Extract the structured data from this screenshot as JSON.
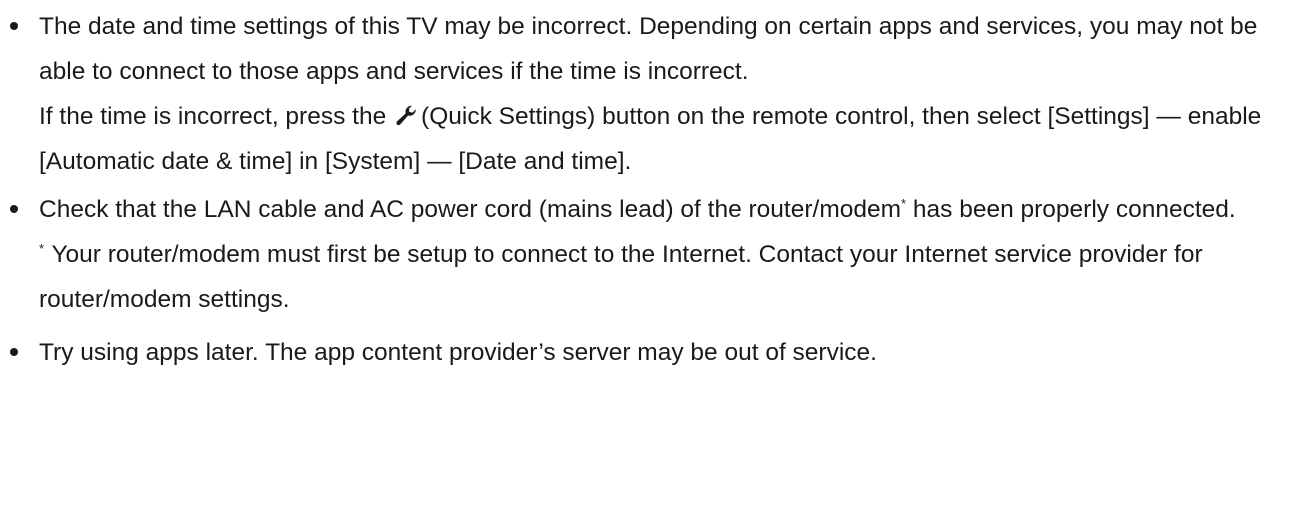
{
  "bullets": {
    "item1": {
      "para1": "The date and time settings of this TV may be incorrect. Depending on certain apps and services, you may not be able to connect to those apps and services if the time is incorrect.",
      "para2_before": "If the time is incorrect, press the",
      "button_name": "(Quick Settings)",
      "para2_after": "button on the remote control, then select [Settings] — enable [Automatic date & time] in [System] — [Date and time].",
      "icon": "wrench-icon"
    },
    "item2": {
      "text_before": "Check that the LAN cable and AC power cord (mains lead) of the router/modem",
      "footnote_mark": "*",
      "text_after": "has been properly connected.",
      "footnote_text": "Your router/modem must first be setup to connect to the Internet. Contact your Internet service provider for router/modem settings."
    },
    "item3": {
      "text": "Try using apps later. The app content provider’s server may be out of service."
    }
  }
}
